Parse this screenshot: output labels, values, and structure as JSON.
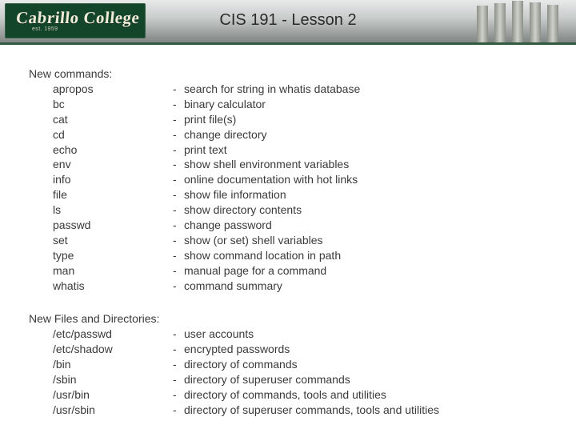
{
  "banner": {
    "logo_script": "Cabrillo College",
    "logo_sub": "est. 1959",
    "title": "CIS 191 - Lesson 2"
  },
  "commands": {
    "heading": "New commands:",
    "items": [
      {
        "term": "apropos",
        "desc": "search for string in whatis database"
      },
      {
        "term": "bc",
        "desc": "binary calculator"
      },
      {
        "term": "cat",
        "desc": "print file(s)"
      },
      {
        "term": "cd",
        "desc": "change directory"
      },
      {
        "term": "echo",
        "desc": "print text"
      },
      {
        "term": "env",
        "desc": "show shell environment variables"
      },
      {
        "term": "info",
        "desc": "online documentation with hot links"
      },
      {
        "term": "file",
        "desc": "show file information"
      },
      {
        "term": "ls",
        "desc": "show directory contents"
      },
      {
        "term": "passwd",
        "desc": "change password"
      },
      {
        "term": "set",
        "desc": "show (or set) shell variables"
      },
      {
        "term": "type",
        "desc": "show command location in path"
      },
      {
        "term": "man",
        "desc": "manual page for a command"
      },
      {
        "term": "whatis",
        "desc": "command summary"
      }
    ]
  },
  "files": {
    "heading": "New Files and Directories:",
    "items": [
      {
        "term": "/etc/passwd",
        "desc": "user accounts"
      },
      {
        "term": "/etc/shadow",
        "desc": "encrypted passwords"
      },
      {
        "term": "/bin",
        "desc": "directory of commands"
      },
      {
        "term": "/sbin",
        "desc": "directory of superuser commands"
      },
      {
        "term": "/usr/bin",
        "desc": "directory of commands, tools and utilities"
      },
      {
        "term": "/usr/sbin",
        "desc": "directory of superuser commands, tools and utilities"
      }
    ]
  },
  "dash": "-"
}
